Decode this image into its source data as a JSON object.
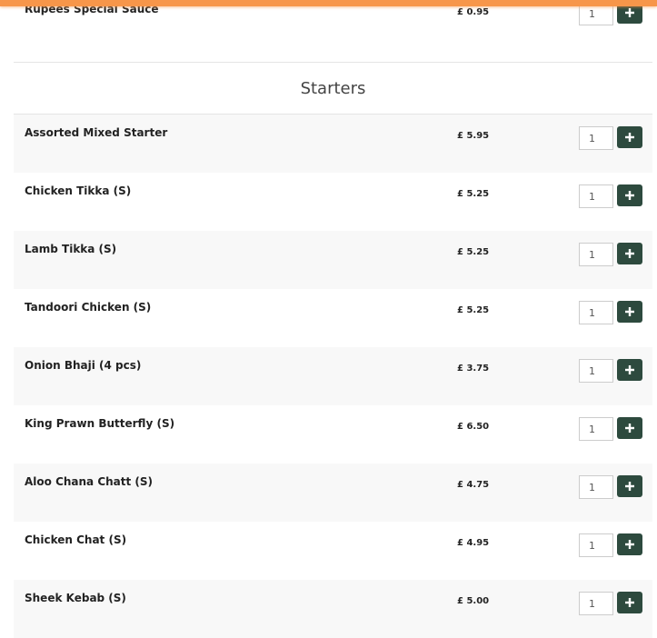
{
  "previous_item": {
    "name": "Rupees Special Sauce",
    "price": "£ 0.95",
    "qty": "1"
  },
  "section": {
    "title": "Starters"
  },
  "items": [
    {
      "name": "Assorted Mixed Starter",
      "price": "£ 5.95",
      "qty": "1"
    },
    {
      "name": "Chicken Tikka (S)",
      "price": "£ 5.25",
      "qty": "1"
    },
    {
      "name": "Lamb Tikka (S)",
      "price": "£ 5.25",
      "qty": "1"
    },
    {
      "name": "Tandoori Chicken (S)",
      "price": "£ 5.25",
      "qty": "1"
    },
    {
      "name": "Onion Bhaji (4 pcs)",
      "price": "£ 3.75",
      "qty": "1"
    },
    {
      "name": "King Prawn Butterfly (S)",
      "price": "£ 6.50",
      "qty": "1"
    },
    {
      "name": "Aloo Chana Chatt (S)",
      "price": "£ 4.75",
      "qty": "1"
    },
    {
      "name": "Chicken Chat (S)",
      "price": "£ 4.95",
      "qty": "1"
    },
    {
      "name": "Sheek Kebab (S)",
      "price": "£ 5.00",
      "qty": "1"
    }
  ],
  "colors": {
    "accent_bar": "#f7964a",
    "add_button": "#2d4a3e"
  },
  "icons": {
    "add": "plus-icon"
  }
}
